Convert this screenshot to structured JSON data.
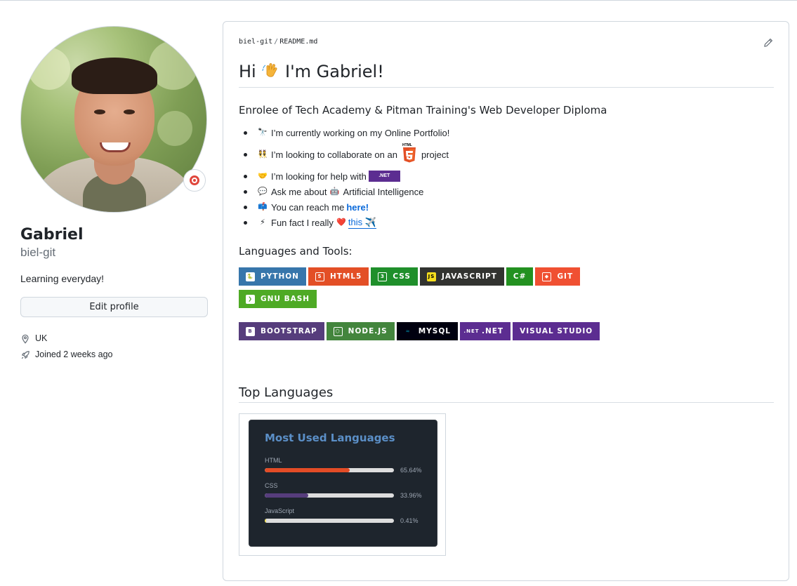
{
  "profile": {
    "name": "Gabriel",
    "login": "biel-git",
    "bio": "Learning everyday!",
    "edit_label": "Edit profile",
    "location": "UK",
    "joined": "Joined 2 weeks ago"
  },
  "readme": {
    "breadcrumb_user": "biel-git",
    "breadcrumb_sep": "/",
    "breadcrumb_file": "README.md",
    "title_pre": "Hi",
    "title_post": "I'm Gabriel!",
    "subtitle": "Enrolee of Tech Academy & Pitman Training's Web Developer Diploma",
    "items": [
      {
        "emoji": "🔭",
        "text": "I’m currently working on my Online Portfolio!"
      },
      {
        "emoji": "👯",
        "text": "I’m looking to collaborate on an",
        "after": "project",
        "html5_label": "HTML"
      },
      {
        "emoji": "🤝",
        "text": "I’m looking for help with",
        "net_label": ".NET"
      },
      {
        "emoji": "💬",
        "text": "Ask me about",
        "emoji2": "🤖",
        "after": "Artificial Intelligence"
      },
      {
        "emoji": "📫",
        "text": "You can reach me",
        "link": "here!"
      },
      {
        "emoji": "⚡",
        "text": "Fun fact I really",
        "emoji2": "❤️",
        "link": "this ✈️"
      }
    ],
    "tools_heading": "Languages and Tools:",
    "badges_row1": [
      {
        "label": "PYTHON",
        "color": "#3776ab",
        "icon": "python-icon"
      },
      {
        "label": "HTML5",
        "color": "#e34f26",
        "icon": "html5-icon"
      },
      {
        "label": "CSS",
        "color": "#1f8f2b",
        "icon": "css3-icon"
      },
      {
        "label": "JAVASCRIPT",
        "color": "#323330",
        "icon": "javascript-icon"
      },
      {
        "label": "C#",
        "color": "#239120",
        "icon": ""
      },
      {
        "label": "GIT",
        "color": "#f05032",
        "icon": "git-icon"
      },
      {
        "label": "GNU BASH",
        "color": "#4eaa25",
        "icon": "bash-icon"
      }
    ],
    "badges_row2": [
      {
        "label": "BOOTSTRAP",
        "color": "#563d7c",
        "icon": "bootstrap-icon"
      },
      {
        "label": "NODE.JS",
        "color": "#43853d",
        "icon": "nodejs-icon"
      },
      {
        "label": "MYSQL",
        "color": "#00000f",
        "icon": "mysql-icon"
      },
      {
        "label": ".NET",
        "color": "#5c2d91",
        "icon": "dotnet-icon"
      },
      {
        "label": "VISUAL STUDIO",
        "color": "#5c2d91",
        "icon": ""
      }
    ],
    "top_languages_heading": "Top Languages",
    "languages_card_title": "Most Used Languages",
    "languages": [
      {
        "name": "HTML",
        "percent": 65.64,
        "label": "65.64%",
        "color": "#e34c26"
      },
      {
        "name": "CSS",
        "percent": 33.96,
        "label": "33.96%",
        "color": "#563d7c"
      },
      {
        "name": "JavaScript",
        "percent": 0.41,
        "label": "0.41%",
        "color": "#f1e05a"
      }
    ]
  }
}
